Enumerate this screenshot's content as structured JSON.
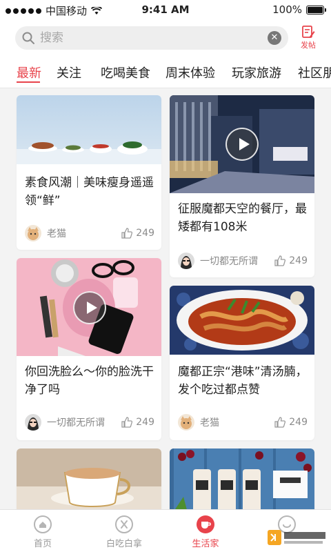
{
  "status_bar": {
    "carrier": "中国移动",
    "time": "9:41 AM",
    "battery": "100%"
  },
  "search": {
    "placeholder": "搜索",
    "clear_icon": "clear-icon",
    "post_label": "发帖"
  },
  "tabs": [
    {
      "label": "最新",
      "active": true
    },
    {
      "label": "关注"
    },
    {
      "label": "吃喝美食"
    },
    {
      "label": "周末体验"
    },
    {
      "label": "玩家旅游"
    },
    {
      "label": "社区朋"
    }
  ],
  "feed": {
    "cards": [
      {
        "title": "素食风潮｜美味瘦身遥遥领“鲜”",
        "author": "老猫",
        "likes": "249",
        "video": false
      },
      {
        "title": "征服魔都天空的餐厅，最矮都有108米",
        "author": "一切都无所谓",
        "likes": "249",
        "video": true
      },
      {
        "title": "你回洗脸么～你的脸洗干净了吗",
        "author": "一切都无所谓",
        "likes": "249",
        "video": true
      },
      {
        "title": "魔都正宗“港味”清汤腩，发个吃过都点赞",
        "author": "老猫",
        "likes": "249",
        "video": false
      }
    ]
  },
  "bottom_nav": [
    {
      "label": "首页",
      "icon": "home-icon"
    },
    {
      "label": "白吃白拿",
      "icon": "cutlery-icon"
    },
    {
      "label": "生活家",
      "icon": "cup-icon",
      "active": true
    },
    {
      "label": "",
      "icon": "smile-icon"
    }
  ],
  "colors": {
    "accent": "#e8434b",
    "background": "#f3f3f3"
  }
}
